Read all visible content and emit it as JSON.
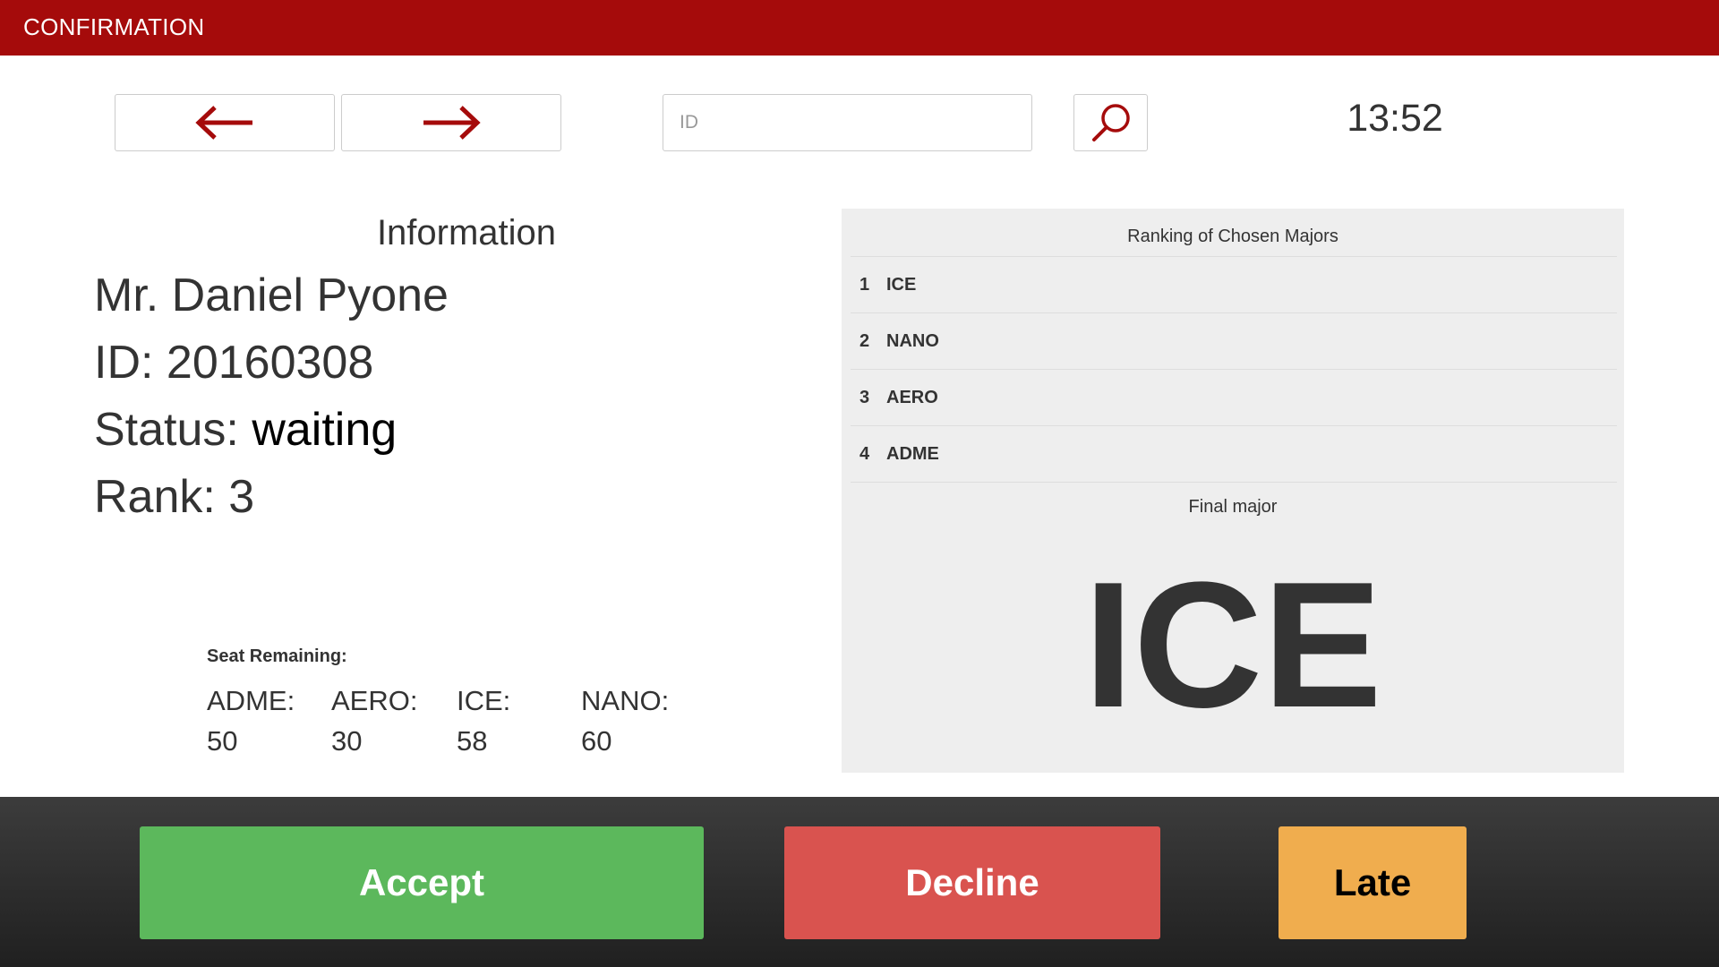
{
  "header": {
    "title": "CONFIRMATION",
    "color": "#a50b0b"
  },
  "toolbar": {
    "prev_icon": "arrow-left-icon",
    "next_icon": "arrow-right-icon",
    "search_placeholder": "ID",
    "search_value": "",
    "search_icon": "magnifier-icon",
    "clock": "13:52"
  },
  "info": {
    "heading": "Information",
    "name": "Mr. Daniel Pyone",
    "id_label": "ID: ",
    "id_value": "20160308",
    "status_label": "Status: ",
    "status_value": "waiting",
    "rank_label": "Rank: ",
    "rank_value": "3"
  },
  "seats": {
    "title": "Seat Remaining:",
    "items": [
      {
        "label": "ADME:",
        "value": "50"
      },
      {
        "label": "AERO:",
        "value": "30"
      },
      {
        "label": "ICE:",
        "value": "58"
      },
      {
        "label": "NANO:",
        "value": "60"
      }
    ]
  },
  "ranking": {
    "title": "Ranking of Chosen Majors",
    "items": [
      {
        "rank": "1",
        "major": "ICE"
      },
      {
        "rank": "2",
        "major": "NANO"
      },
      {
        "rank": "3",
        "major": "AERO"
      },
      {
        "rank": "4",
        "major": "ADME"
      }
    ],
    "final_label": "Final major",
    "final_major": "ICE"
  },
  "actions": {
    "accept": "Accept",
    "decline": "Decline",
    "late": "Late",
    "accept_color": "#5cb85c",
    "decline_color": "#d9534f",
    "late_color": "#f0ad4e"
  }
}
